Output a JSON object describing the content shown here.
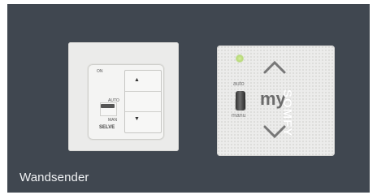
{
  "caption": "Wandsender",
  "left_switch": {
    "top_label": "ON",
    "auto_label": "AUTO",
    "man_label": "MAN",
    "brand": "SELVE"
  },
  "right_switch": {
    "brand": "SOMFY",
    "center_label": "my",
    "auto_label": "auto",
    "manu_label": "manu",
    "led_color": "#b7d97a"
  },
  "colors": {
    "background": "#404750",
    "caption_text": "#f0f2f4"
  }
}
